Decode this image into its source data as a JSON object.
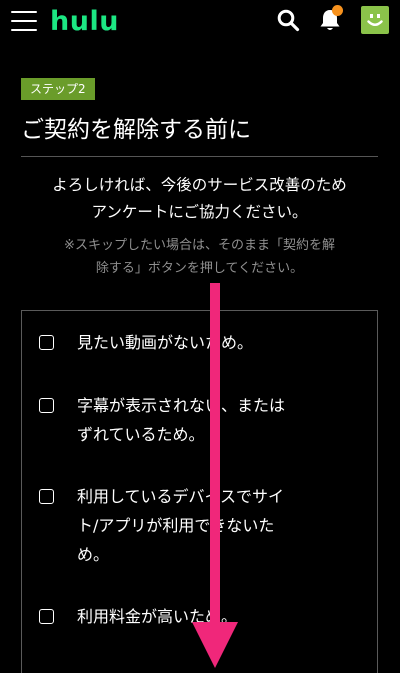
{
  "header": {
    "logo_text": "hulu",
    "menu_icon": "hamburger-icon",
    "search_icon": "search-icon",
    "bell_icon": "bell-icon",
    "avatar_icon": "smiley-avatar-icon",
    "notification_dot_color": "#f7921e",
    "brand_color": "#1ce783"
  },
  "step": {
    "badge": "ステップ2",
    "badge_color": "#6a9c2a"
  },
  "main": {
    "title": "ご契約を解除する前に",
    "intro_line1": "よろしければ、今後のサービス改善のため",
    "intro_line2": "アンケートにご協力ください。",
    "note_line1": "※スキップしたい場合は、そのまま「契約を解",
    "note_line2": "除する」ボタンを押してください。"
  },
  "survey": {
    "options": [
      {
        "lines": [
          "見たい動画がないため。"
        ]
      },
      {
        "lines": [
          "字幕が表示されない、または",
          "ずれているため。"
        ]
      },
      {
        "lines": [
          "利用しているデバイスでサイ",
          "ト/アプリが利用できないた",
          "め。"
        ]
      },
      {
        "lines": [
          "利用料金が高いため。"
        ]
      }
    ]
  },
  "overlay": {
    "arrow_icon": "down-arrow-icon",
    "arrow_color": "#f0277a"
  }
}
